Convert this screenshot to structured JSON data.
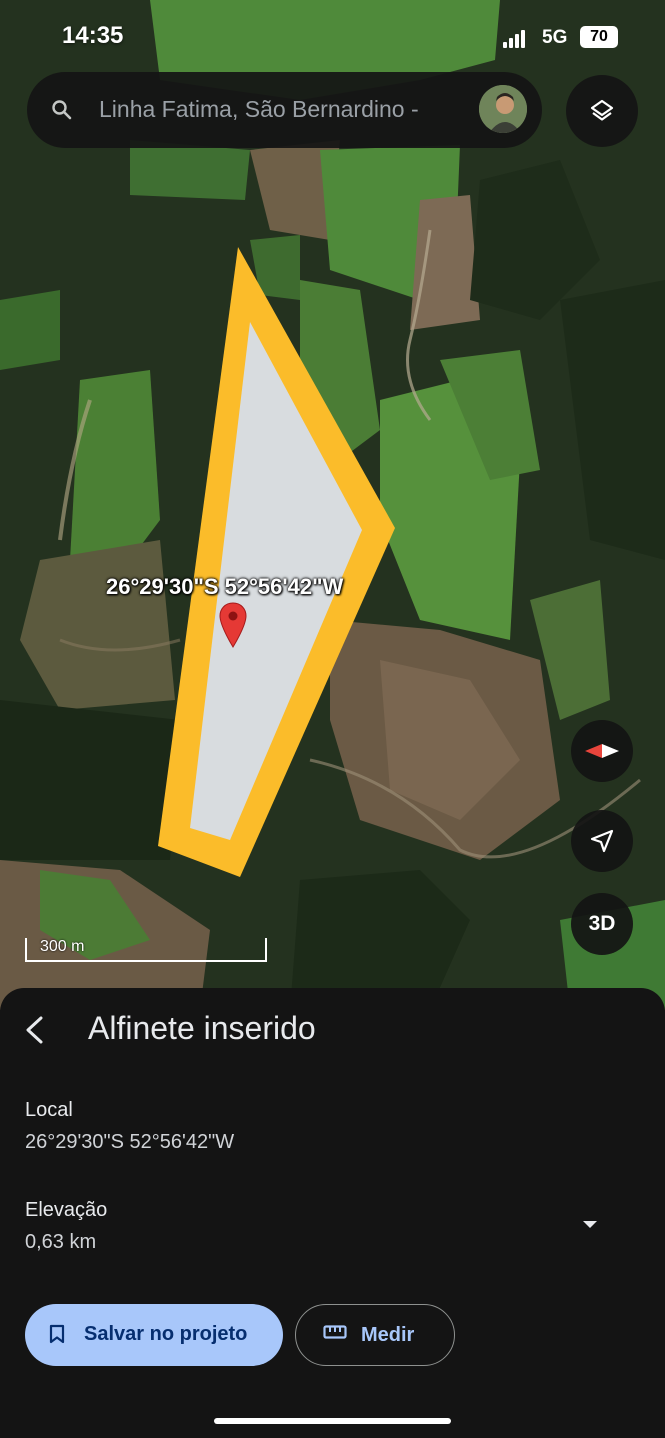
{
  "status_bar": {
    "time": "14:35",
    "network": "5G",
    "battery": "70"
  },
  "search": {
    "text": "Linha Fatima, São Bernardino -",
    "icon": "search-icon"
  },
  "map": {
    "pin_coordinates": "26°29'30\"S 52°56'42\"W",
    "scale_label": "300 m",
    "btn_3d": "3D",
    "colors": {
      "polygon_outline": "#fbbc2a",
      "polygon_fill": "#d8dcdf",
      "pin": "#e53935"
    }
  },
  "sheet": {
    "title": "Alfinete inserido",
    "local_label": "Local",
    "local_value": "26°29'30\"S 52°56'42\"W",
    "elevation_label": "Elevação",
    "elevation_value": "0,63 km",
    "save_label": "Salvar no projeto",
    "measure_label": "Medir",
    "colors": {
      "save_bg": "#a8c7fa",
      "background": "#141414"
    }
  }
}
